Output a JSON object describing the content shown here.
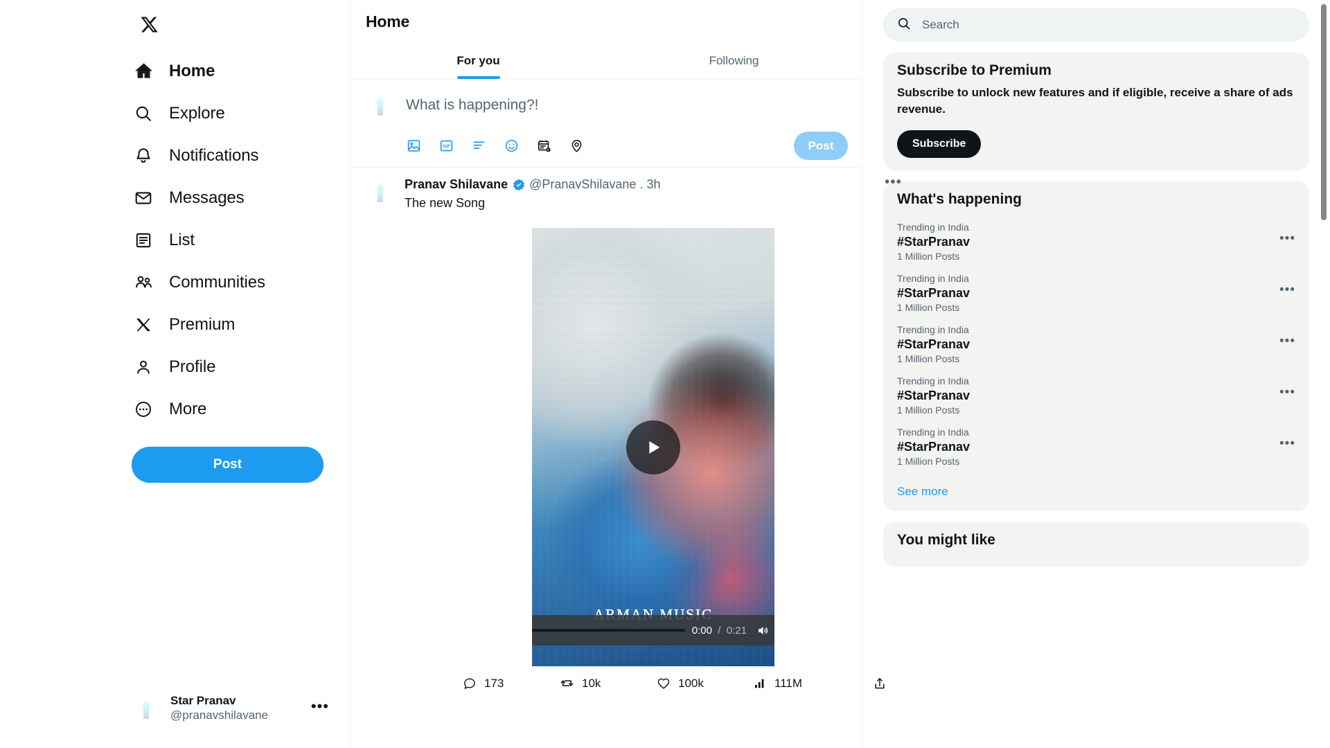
{
  "sidebar": {
    "logo": "x-logo",
    "items": [
      {
        "label": "Home",
        "icon": "home-icon",
        "active": true
      },
      {
        "label": "Explore",
        "icon": "search-icon",
        "active": false
      },
      {
        "label": "Notifications",
        "icon": "bell-icon",
        "active": false
      },
      {
        "label": "Messages",
        "icon": "envelope-icon",
        "active": false
      },
      {
        "label": "List",
        "icon": "list-icon",
        "active": false
      },
      {
        "label": "Communities",
        "icon": "people-icon",
        "active": false
      },
      {
        "label": "Premium",
        "icon": "x-icon",
        "active": false
      },
      {
        "label": "Profile",
        "icon": "person-icon",
        "active": false
      },
      {
        "label": "More",
        "icon": "more-circle-icon",
        "active": false
      }
    ],
    "post_button": "Post",
    "account": {
      "name": "Star Pranav",
      "handle": "@pranavshilavane",
      "menu_icon": "ellipsis-icon"
    }
  },
  "main": {
    "title": "Home",
    "tabs": [
      {
        "label": "For you",
        "active": true
      },
      {
        "label": "Following",
        "active": false
      }
    ],
    "compose": {
      "placeholder": "What is happening?!",
      "post_label": "Post",
      "icons": [
        "image-icon",
        "gif-icon",
        "poll-icon",
        "emoji-icon",
        "schedule-icon",
        "location-icon"
      ]
    },
    "tweet": {
      "display_name": "Pranav Shilavane",
      "verified": true,
      "handle": "@PranavShilavane",
      "separator": ".",
      "timestamp": "3h",
      "menu_icon": "ellipsis-icon",
      "text": "The new Song",
      "video": {
        "watermark": "ARMAN MUSIC",
        "current_time": "0:00",
        "separator": "/",
        "duration": "0:21",
        "play_icon": "play-icon",
        "volume_icon": "volume-icon",
        "fullscreen_icon": "fullscreen-icon",
        "progress_percent": 0,
        "volume_percent": 100
      },
      "actions": [
        {
          "icon": "reply-icon",
          "count": "173"
        },
        {
          "icon": "retweet-icon",
          "count": "10k"
        },
        {
          "icon": "like-icon",
          "count": "100k"
        },
        {
          "icon": "views-icon",
          "count": "111M"
        },
        {
          "icon": "share-icon",
          "count": ""
        }
      ]
    }
  },
  "right": {
    "search": {
      "placeholder": "Search",
      "icon": "search-icon"
    },
    "premium": {
      "title": "Subscribe to Premium",
      "description": "Subscribe to unlock new features and if eligible, receive a share of ads revenue.",
      "button": "Subscribe"
    },
    "whats_happening": {
      "title": "What's happening",
      "trends": [
        {
          "category": "Trending in India",
          "tag": "#StarPranav",
          "count": "1 Million Posts"
        },
        {
          "category": "Trending in India",
          "tag": "#StarPranav",
          "count": "1 Million Posts"
        },
        {
          "category": "Trending in India",
          "tag": "#StarPranav",
          "count": "1 Million Posts"
        },
        {
          "category": "Trending in India",
          "tag": "#StarPranav",
          "count": "1 Million Posts"
        },
        {
          "category": "Trending in India",
          "tag": "#StarPranav",
          "count": "1 Million Posts"
        }
      ],
      "see_more": "See more"
    },
    "you_might_like": {
      "title": "You might like"
    }
  },
  "colors": {
    "accent": "#1d9bf0",
    "accent_disabled": "#8ecdf8",
    "text_primary": "#0f1419",
    "text_secondary": "#536471",
    "card_bg": "#f3f3f1",
    "search_bg": "#eff3f4",
    "dark": "#0f1419"
  }
}
